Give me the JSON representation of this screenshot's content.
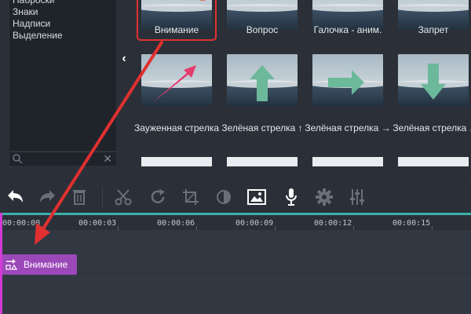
{
  "categories": {
    "items": [
      "Наброски",
      "Знаки",
      "Надписи",
      "Выделение"
    ],
    "search": {
      "placeholder": ""
    }
  },
  "stickers": [
    {
      "label": "Внимание",
      "state": "selected"
    },
    {
      "label": "Вопрос"
    },
    {
      "label": "Галочка - аним."
    },
    {
      "label": "Запрет"
    },
    {
      "label": "Зауженная стрелка",
      "icon": "pink-arrow-up-right"
    },
    {
      "label": "Зелёная стрелка ↑",
      "icon": "green-arrow-up"
    },
    {
      "label": "Зелёная стрелка →",
      "icon": "green-arrow-right"
    },
    {
      "label": "Зелёная стрелка ↓",
      "icon": "green-arrow-down"
    }
  ],
  "toolbar": {
    "buttons": [
      "undo",
      "redo",
      "delete",
      "cut",
      "rotate",
      "crop",
      "color-adjust",
      "insert-image",
      "record-voice",
      "settings",
      "equalizer"
    ]
  },
  "timeline": {
    "ticks": [
      "00:00:00",
      "00:00:03",
      "00:00:06",
      "00:00:09",
      "00:00:12",
      "00:00:15"
    ],
    "clip": {
      "label": "Внимание"
    }
  },
  "colors": {
    "accent": "#3ab0a8",
    "clip": "#9b48b9",
    "playhead": "#d23ad8",
    "annotation": "#e03030"
  }
}
